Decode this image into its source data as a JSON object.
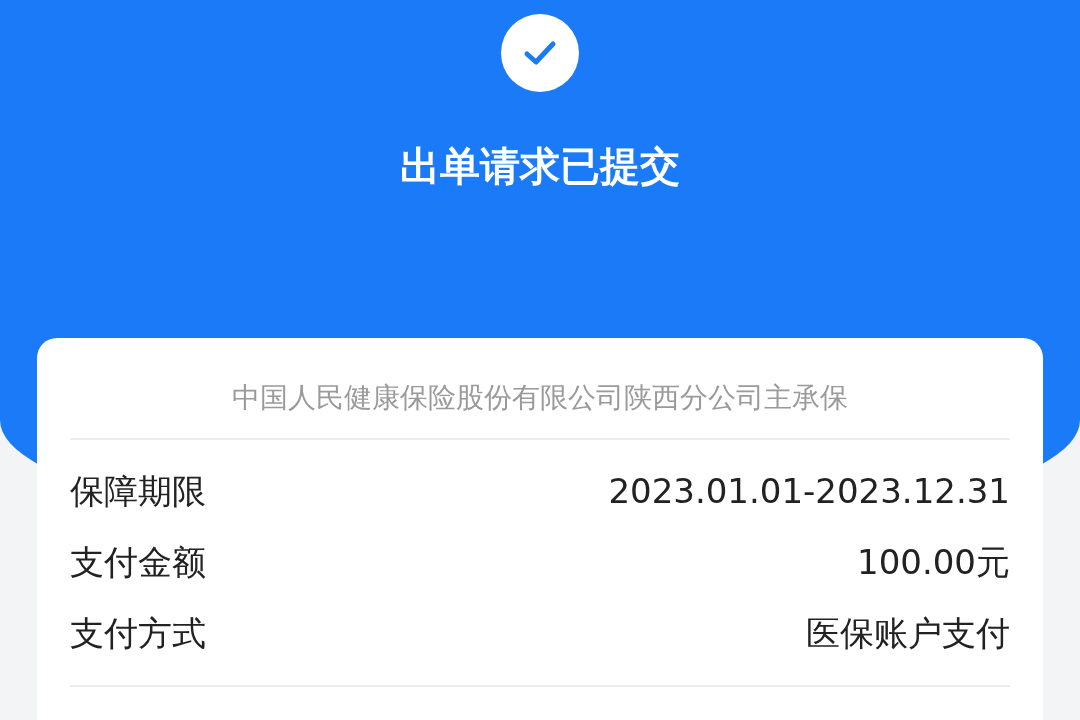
{
  "header": {
    "title": "出单请求已提交"
  },
  "card": {
    "insurer": "中国人民健康保险股份有限公司陕西分公司主承保",
    "rows": [
      {
        "label": "保障期限",
        "value": "2023.01.01-2023.12.31"
      },
      {
        "label": "支付金额",
        "value": "100.00元"
      },
      {
        "label": "支付方式",
        "value": "医保账户支付"
      }
    ]
  }
}
